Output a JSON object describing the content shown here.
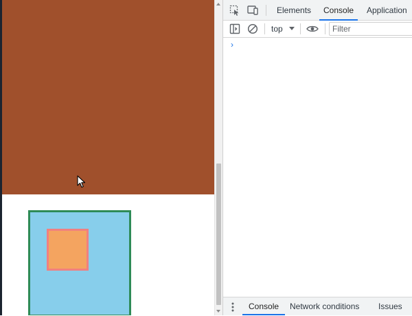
{
  "devtools": {
    "tabs": [
      {
        "label": "Elements",
        "active": false
      },
      {
        "label": "Console",
        "active": true
      },
      {
        "label": "Application",
        "active": false
      }
    ],
    "toolbar": {
      "context": "top",
      "filter_placeholder": "Filter"
    },
    "console": {
      "prompt": "›"
    },
    "drawer": {
      "tabs": [
        {
          "label": "Console",
          "active": true
        },
        {
          "label": "Network conditions",
          "active": false
        },
        {
          "label": "Issues",
          "active": false
        }
      ]
    },
    "accent_color": "#1a73e8"
  },
  "page": {
    "colors": {
      "block_fill": "#a0502c",
      "outer_fill": "#87ceeb",
      "outer_border": "#2e8b57",
      "inner_fill": "#f4a460",
      "inner_border": "#f08080"
    }
  }
}
